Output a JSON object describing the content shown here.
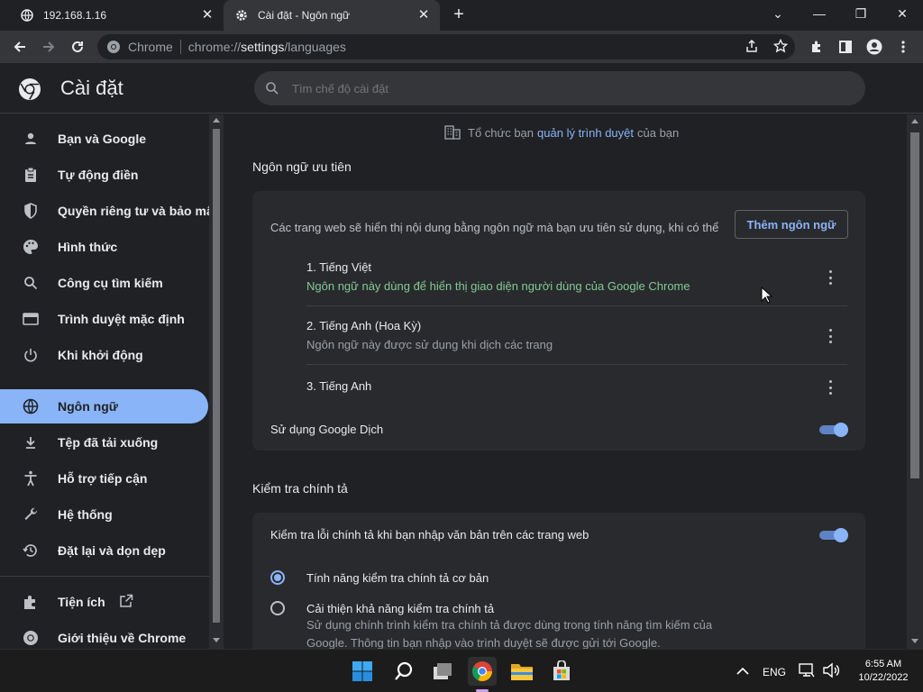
{
  "tabs": [
    {
      "title": "192.168.1.16",
      "icon": "globe-icon"
    },
    {
      "title": "Cài đặt - Ngôn ngữ",
      "icon": "gear-icon"
    }
  ],
  "omnibox": {
    "chip": "Chrome",
    "url_prefix": "chrome://",
    "url_host": "settings",
    "url_path": "/languages"
  },
  "settings": {
    "title": "Cài đặt",
    "search_placeholder": "Tìm chế độ cài đặt"
  },
  "sidebar": {
    "items": [
      {
        "label": "Bạn và Google",
        "icon": "person-icon"
      },
      {
        "label": "Tự động điền",
        "icon": "clipboard-icon"
      },
      {
        "label": "Quyền riêng tư và bảo mật",
        "icon": "shield-icon"
      },
      {
        "label": "Hình thức",
        "icon": "palette-icon"
      },
      {
        "label": "Công cụ tìm kiếm",
        "icon": "search-icon"
      },
      {
        "label": "Trình duyệt mặc định",
        "icon": "browser-icon"
      },
      {
        "label": "Khi khởi động",
        "icon": "power-icon"
      },
      {
        "label": "Ngôn ngữ",
        "icon": "globe-icon",
        "active": true
      },
      {
        "label": "Tệp đã tải xuống",
        "icon": "download-icon"
      },
      {
        "label": "Hỗ trợ tiếp cận",
        "icon": "accessibility-icon"
      },
      {
        "label": "Hệ thống",
        "icon": "wrench-icon"
      },
      {
        "label": "Đặt lại và dọn dẹp",
        "icon": "restore-icon"
      }
    ],
    "extensions_label": "Tiện ích",
    "about_label": "Giới thiệu về Chrome"
  },
  "main": {
    "managed_prefix": "Tổ chức bạn",
    "managed_link": "quản lý trình duyệt",
    "managed_suffix": "của bạn",
    "preferred_title": "Ngôn ngữ ưu tiên",
    "preferred_desc": "Các trang web sẽ hiển thị nội dung bằng ngôn ngữ mà bạn ưu tiên sử dụng, khi có thể",
    "add_language_button": "Thêm ngôn ngữ",
    "languages": [
      {
        "name": "1. Tiếng Việt",
        "sub": "Ngôn ngữ này dùng để hiển thị giao diện người dùng của Google Chrome"
      },
      {
        "name": "2. Tiếng Anh (Hoa Kỳ)",
        "sub": "Ngôn ngữ này được sử dụng khi dịch các trang"
      },
      {
        "name": "3. Tiếng Anh",
        "sub": ""
      }
    ],
    "translate_label": "Sử dụng Google Dịch",
    "translate_on": true,
    "spell_title": "Kiểm tra chính tả",
    "spell_toggle_label": "Kiểm tra lỗi chính tả khi bạn nhập văn bản trên các trang web",
    "spell_on": true,
    "spell_basic": "Tính năng kiểm tra chính tả cơ bản",
    "spell_enhanced": "Cải thiện khả năng kiểm tra chính tả",
    "spell_enhanced_desc": "Sử dụng chính trình kiểm tra chính tả được dùng trong tính năng tìm kiếm của Google. Thông tin bạn nhập vào trình duyệt sẽ được gửi tới Google."
  },
  "taskbar": {
    "lang": "ENG",
    "time": "6:55 AM",
    "date": "10/22/2022"
  },
  "colors": {
    "accent": "#8ab4f8",
    "background": "#202124",
    "card": "#292a2d",
    "green_text": "#81c995"
  }
}
